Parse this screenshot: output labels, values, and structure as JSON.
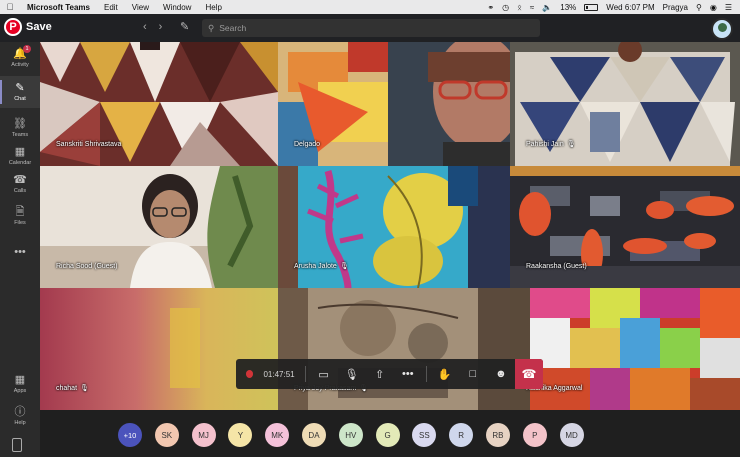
{
  "menubar": {
    "app_name": "Microsoft Teams",
    "menus": [
      "Edit",
      "View",
      "Window",
      "Help"
    ],
    "battery": "13%",
    "clock": "Wed 6:07 PM",
    "user": "Pragya"
  },
  "titlebar": {
    "save_label": "Save",
    "pin_letter": "P",
    "search_placeholder": "Search"
  },
  "rail": {
    "activity": "Activity",
    "activity_badge": "1",
    "chat": "Chat",
    "teams": "Teams",
    "calendar": "Calendar",
    "calls": "Calls",
    "files": "Files",
    "more": "•••",
    "apps": "Apps",
    "help": "Help"
  },
  "tiles": [
    {
      "name": "Sanskriti Shrivastava",
      "muted": false
    },
    {
      "name": "Delgado",
      "muted": false
    },
    {
      "name": "Pahishi Jain",
      "muted": true
    },
    {
      "name": "Richa Sood (Guest)",
      "muted": false
    },
    {
      "name": "Arusha Jalote",
      "muted": true
    },
    {
      "name": "Raakansha (Guest)",
      "muted": false
    },
    {
      "name": "chahat",
      "muted": true
    },
    {
      "name": "Priya Joy Prakasam",
      "muted": true
    },
    {
      "name": "Radhika Aggarwal",
      "muted": false
    }
  ],
  "controls": {
    "timer": "01:47:51"
  },
  "colors": {
    "accent": "#4b53bc",
    "hangup": "#c4314b",
    "record": "#d13438"
  },
  "participants": {
    "more_count": "+10",
    "initials": [
      {
        "label": "SK",
        "color": "#f2c7b0"
      },
      {
        "label": "MJ",
        "color": "#f4c1cd"
      },
      {
        "label": "Y",
        "color": "#f5e5a7"
      },
      {
        "label": "MK",
        "color": "#f4c1d9"
      },
      {
        "label": "DA",
        "color": "#efdcb6"
      },
      {
        "label": "HV",
        "color": "#cde6c9"
      },
      {
        "label": "G",
        "color": "#e3eab8"
      },
      {
        "label": "SS",
        "color": "#d9d9ef"
      },
      {
        "label": "R",
        "color": "#cfd7ec"
      },
      {
        "label": "RB",
        "color": "#e7d3c3"
      },
      {
        "label": "P",
        "color": "#f3c3c9"
      },
      {
        "label": "MD",
        "color": "#d6d6e4"
      }
    ]
  }
}
